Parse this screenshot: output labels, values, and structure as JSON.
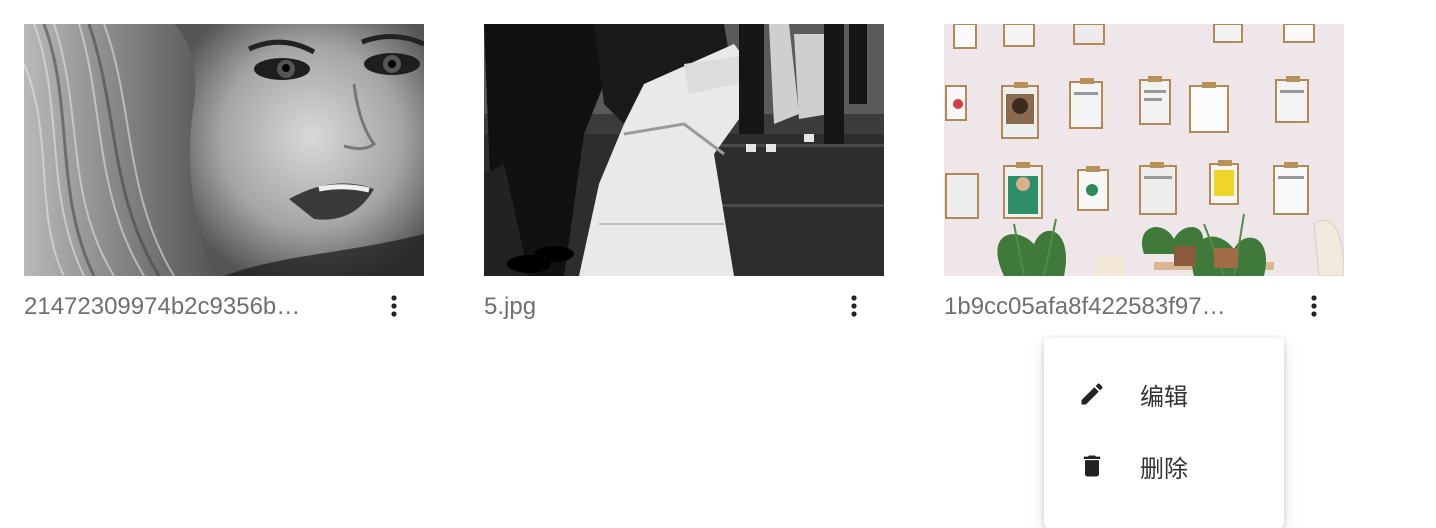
{
  "gallery": {
    "items": [
      {
        "filename": "21472309974b2c9356b…",
        "image": "grayscale-portrait-woman",
        "more_icon": "more-vertical-icon"
      },
      {
        "filename": "5.jpg",
        "image": "black-white-street-kiss-photo",
        "more_icon": "more-vertical-icon"
      },
      {
        "filename": "1b9cc05afa8f422583f97…",
        "image": "wall-of-clipboards-with-plants",
        "more_icon": "more-vertical-icon"
      }
    ]
  },
  "context_menu": {
    "items": [
      {
        "label": "编辑",
        "icon": "pencil-icon"
      },
      {
        "label": "删除",
        "icon": "trash-icon"
      }
    ]
  },
  "colors": {
    "filename_text": "#6f6f6f",
    "icon": "#222222",
    "menu_text": "#333333"
  }
}
